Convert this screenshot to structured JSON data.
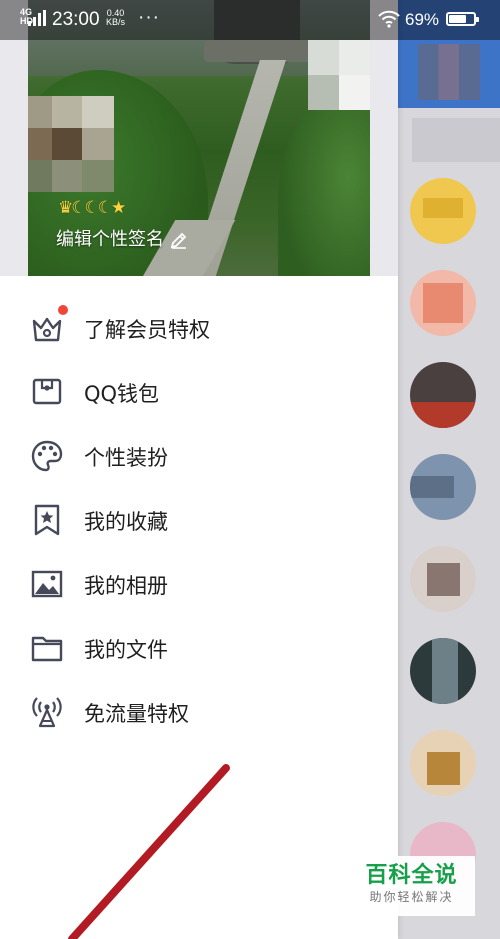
{
  "status_bar": {
    "network": "4G HD",
    "time": "23:00",
    "speed_value": "0.40",
    "speed_unit": "KB/s",
    "more": "···",
    "battery_text": "69%",
    "battery_level": 0.69
  },
  "profile": {
    "rating_icons": "♛☾☾☾★",
    "signature_label": "编辑个性签名",
    "edit_icon": "pencil-icon"
  },
  "menu": {
    "items": [
      {
        "label": "了解会员特权",
        "icon": "crown-icon",
        "badge": true
      },
      {
        "label": "QQ钱包",
        "icon": "wallet-icon"
      },
      {
        "label": "个性装扮",
        "icon": "palette-icon"
      },
      {
        "label": "我的收藏",
        "icon": "bookmark-star-icon"
      },
      {
        "label": "我的相册",
        "icon": "photo-album-icon"
      },
      {
        "label": "我的文件",
        "icon": "folder-icon"
      },
      {
        "label": "免流量特权",
        "icon": "broadcast-antenna-icon"
      }
    ]
  },
  "watermark": {
    "title": "百科全说",
    "subtitle": "助你轻松解决"
  },
  "colors": {
    "accent_badge": "#f0463a",
    "icon_gray": "#45495a",
    "annotation_arrow": "#b31b24",
    "watermark_green": "#17a04a"
  }
}
